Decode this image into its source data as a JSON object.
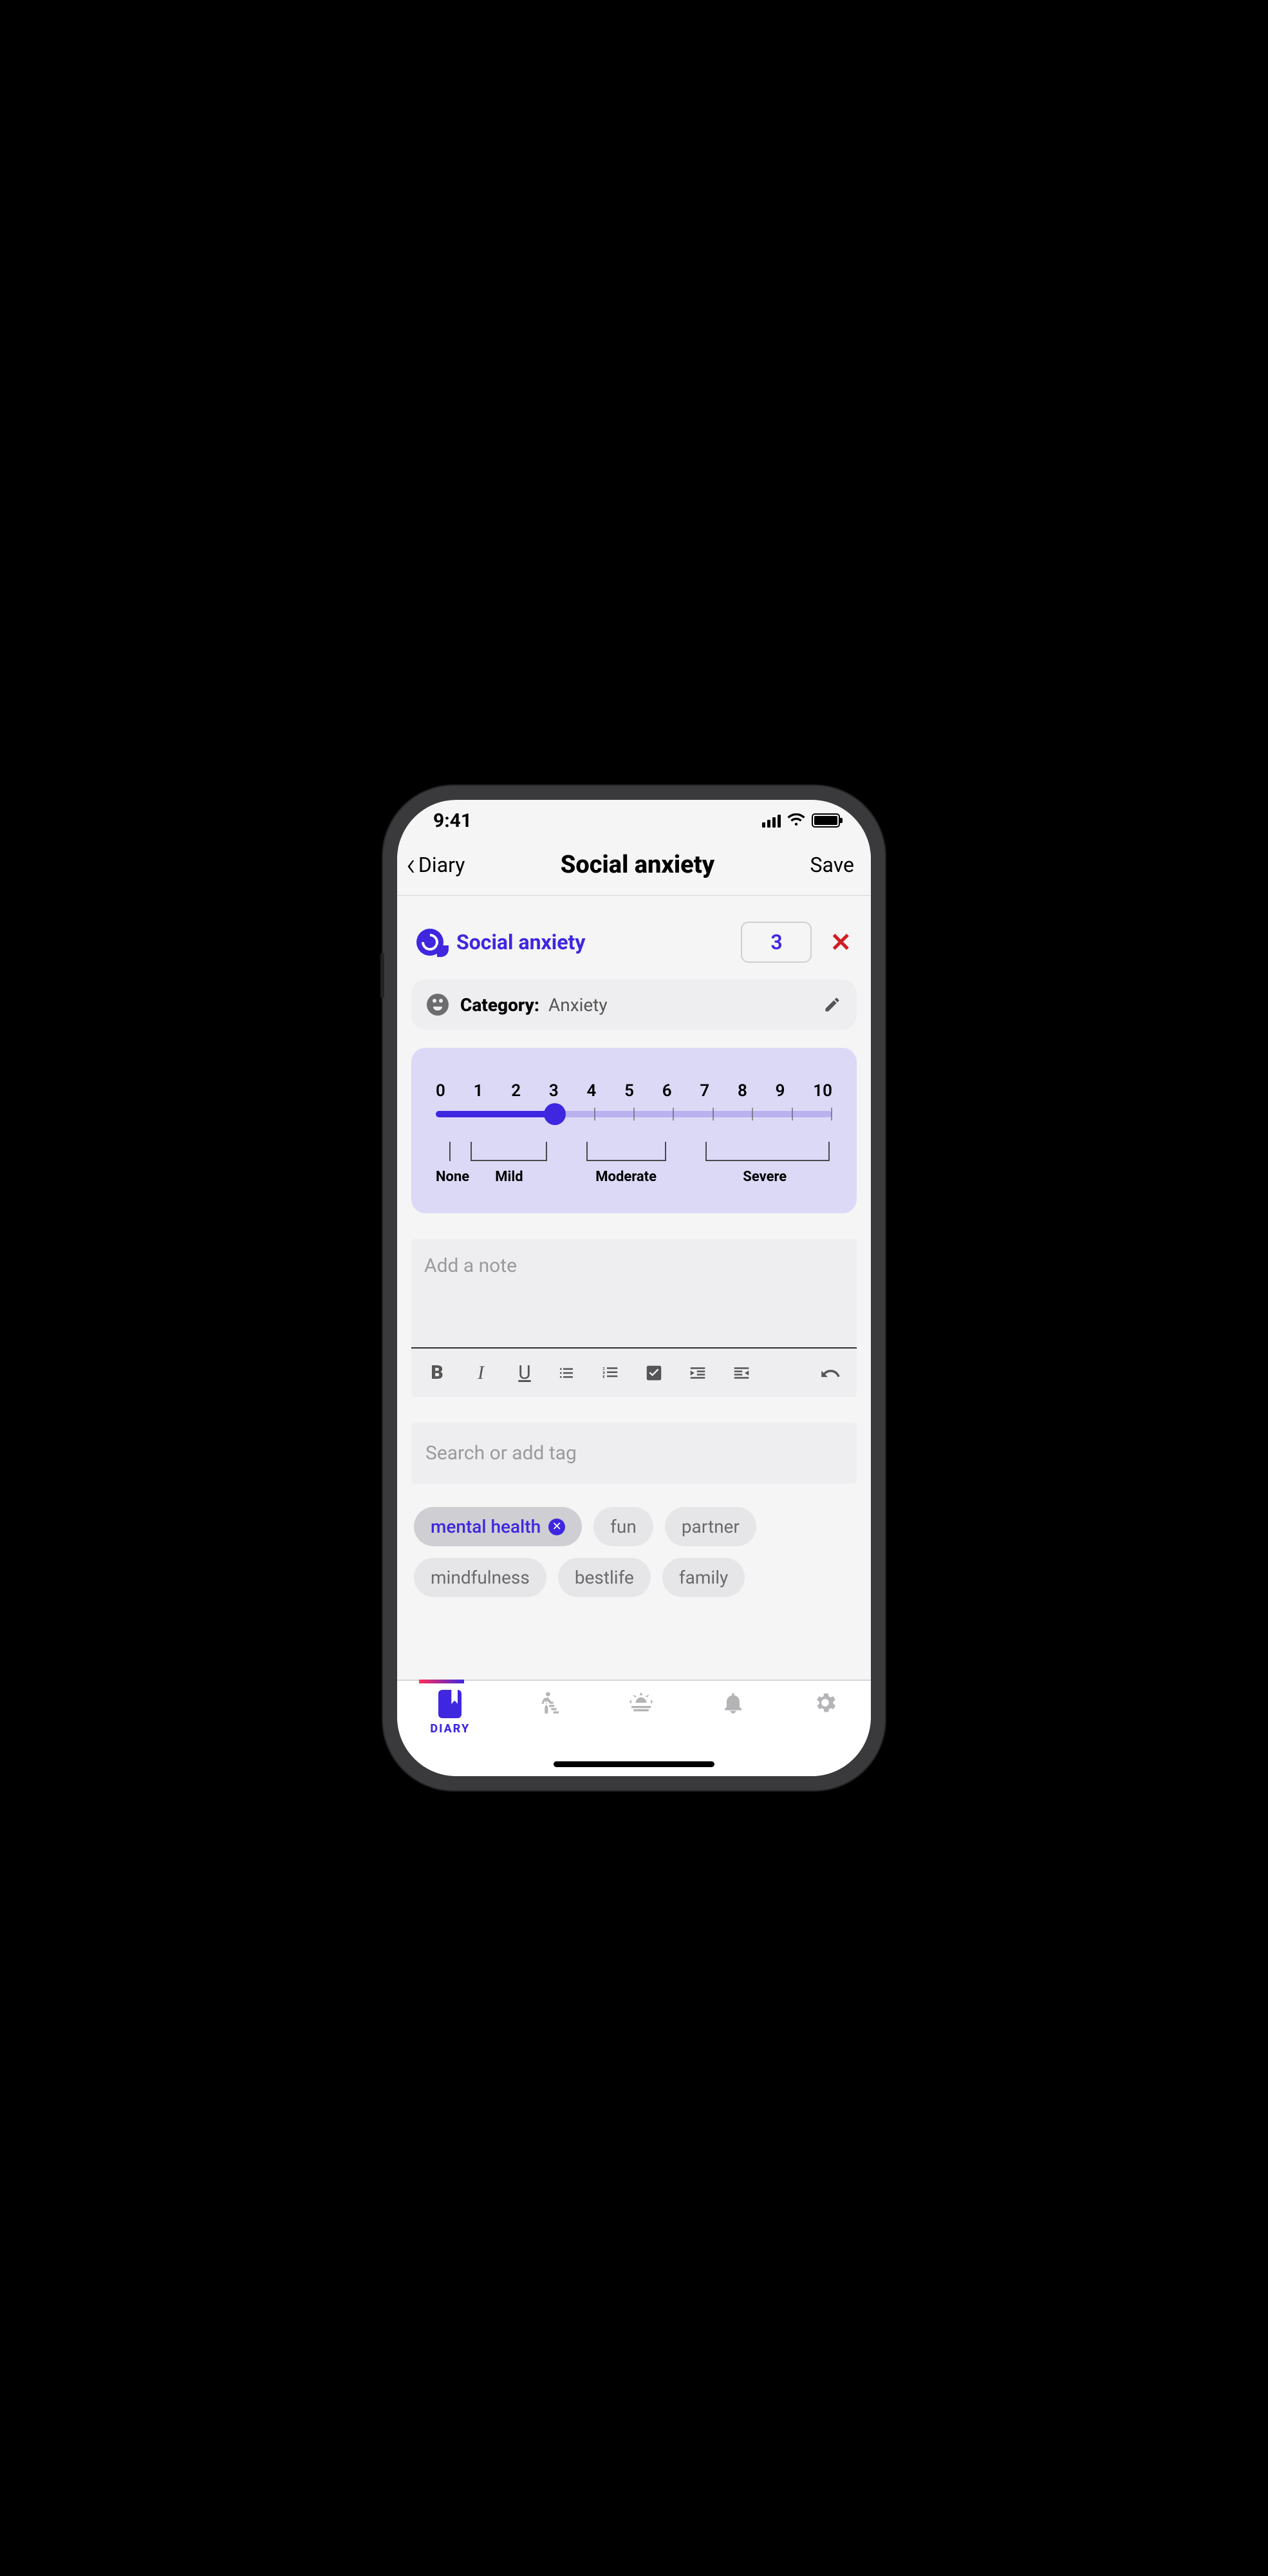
{
  "status": {
    "time": "9:41"
  },
  "nav": {
    "back_label": "Diary",
    "title": "Social anxiety",
    "save_label": "Save"
  },
  "symptom": {
    "name": "Social anxiety",
    "value": "3"
  },
  "category": {
    "label": "Category:",
    "value": "Anxiety"
  },
  "slider": {
    "ticks": [
      "0",
      "1",
      "2",
      "3",
      "4",
      "5",
      "6",
      "7",
      "8",
      "9",
      "10"
    ],
    "value": 3,
    "ranges": {
      "none": "None",
      "mild": "Mild",
      "moderate": "Moderate",
      "severe": "Severe"
    }
  },
  "note": {
    "placeholder": "Add a note"
  },
  "tag_search": {
    "placeholder": "Search or add tag"
  },
  "tags": [
    {
      "label": "mental health",
      "active": true
    },
    {
      "label": "fun",
      "active": false
    },
    {
      "label": "partner",
      "active": false
    },
    {
      "label": "mindfulness",
      "active": false
    },
    {
      "label": "bestlife",
      "active": false
    },
    {
      "label": "family",
      "active": false
    }
  ],
  "tabs": {
    "diary": "DIARY"
  }
}
